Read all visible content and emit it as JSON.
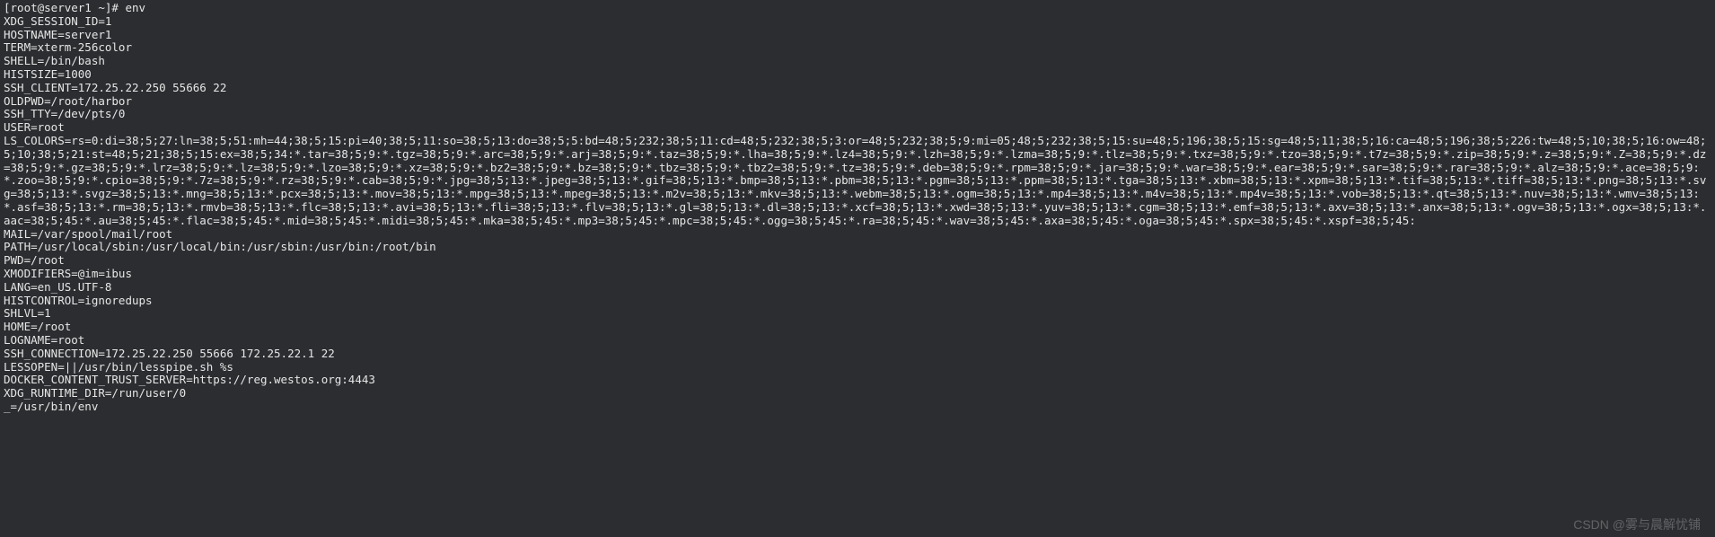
{
  "terminal": {
    "prompt": "[root@server1 ~]# env",
    "lines": [
      "XDG_SESSION_ID=1",
      "HOSTNAME=server1",
      "TERM=xterm-256color",
      "SHELL=/bin/bash",
      "HISTSIZE=1000",
      "SSH_CLIENT=172.25.22.250 55666 22",
      "OLDPWD=/root/harbor",
      "SSH_TTY=/dev/pts/0",
      "USER=root",
      "LS_COLORS=rs=0:di=38;5;27:ln=38;5;51:mh=44;38;5;15:pi=40;38;5;11:so=38;5;13:do=38;5;5:bd=48;5;232;38;5;11:cd=48;5;232;38;5;3:or=48;5;232;38;5;9:mi=05;48;5;232;38;5;15:su=48;5;196;38;5;15:sg=48;5;11;38;5;16:ca=48;5;196;38;5;226:tw=48;5;10;38;5;16:ow=48;5;10;38;5;21:st=48;5;21;38;5;15:ex=38;5;34:*.tar=38;5;9:*.tgz=38;5;9:*.arc=38;5;9:*.arj=38;5;9:*.taz=38;5;9:*.lha=38;5;9:*.lz4=38;5;9:*.lzh=38;5;9:*.lzma=38;5;9:*.tlz=38;5;9:*.txz=38;5;9:*.tzo=38;5;9:*.t7z=38;5;9:*.zip=38;5;9:*.z=38;5;9:*.Z=38;5;9:*.dz=38;5;9:*.gz=38;5;9:*.lrz=38;5;9:*.lz=38;5;9:*.lzo=38;5;9:*.xz=38;5;9:*.bz2=38;5;9:*.bz=38;5;9:*.tbz=38;5;9:*.tbz2=38;5;9:*.tz=38;5;9:*.deb=38;5;9:*.rpm=38;5;9:*.jar=38;5;9:*.war=38;5;9:*.ear=38;5;9:*.sar=38;5;9:*.rar=38;5;9:*.alz=38;5;9:*.ace=38;5;9:*.zoo=38;5;9:*.cpio=38;5;9:*.7z=38;5;9:*.rz=38;5;9:*.cab=38;5;9:*.jpg=38;5;13:*.jpeg=38;5;13:*.gif=38;5;13:*.bmp=38;5;13:*.pbm=38;5;13:*.pgm=38;5;13:*.ppm=38;5;13:*.tga=38;5;13:*.xbm=38;5;13:*.xpm=38;5;13:*.tif=38;5;13:*.tiff=38;5;13:*.png=38;5;13:*.svg=38;5;13:*.svgz=38;5;13:*.mng=38;5;13:*.pcx=38;5;13:*.mov=38;5;13:*.mpg=38;5;13:*.mpeg=38;5;13:*.m2v=38;5;13:*.mkv=38;5;13:*.webm=38;5;13:*.ogm=38;5;13:*.mp4=38;5;13:*.m4v=38;5;13:*.mp4v=38;5;13:*.vob=38;5;13:*.qt=38;5;13:*.nuv=38;5;13:*.wmv=38;5;13:*.asf=38;5;13:*.rm=38;5;13:*.rmvb=38;5;13:*.flc=38;5;13:*.avi=38;5;13:*.fli=38;5;13:*.flv=38;5;13:*.gl=38;5;13:*.dl=38;5;13:*.xcf=38;5;13:*.xwd=38;5;13:*.yuv=38;5;13:*.cgm=38;5;13:*.emf=38;5;13:*.axv=38;5;13:*.anx=38;5;13:*.ogv=38;5;13:*.ogx=38;5;13:*.aac=38;5;45:*.au=38;5;45:*.flac=38;5;45:*.mid=38;5;45:*.midi=38;5;45:*.mka=38;5;45:*.mp3=38;5;45:*.mpc=38;5;45:*.ogg=38;5;45:*.ra=38;5;45:*.wav=38;5;45:*.axa=38;5;45:*.oga=38;5;45:*.spx=38;5;45:*.xspf=38;5;45:",
      "MAIL=/var/spool/mail/root",
      "PATH=/usr/local/sbin:/usr/local/bin:/usr/sbin:/usr/bin:/root/bin",
      "PWD=/root",
      "XMODIFIERS=@im=ibus",
      "LANG=en_US.UTF-8",
      "HISTCONTROL=ignoredups",
      "SHLVL=1",
      "HOME=/root",
      "LOGNAME=root",
      "SSH_CONNECTION=172.25.22.250 55666 172.25.22.1 22",
      "LESSOPEN=||/usr/bin/lesspipe.sh %s",
      "DOCKER_CONTENT_TRUST_SERVER=https://reg.westos.org:4443",
      "XDG_RUNTIME_DIR=/run/user/0",
      "_=/usr/bin/env"
    ]
  },
  "watermark": "CSDN @雾与晨解忧铺"
}
